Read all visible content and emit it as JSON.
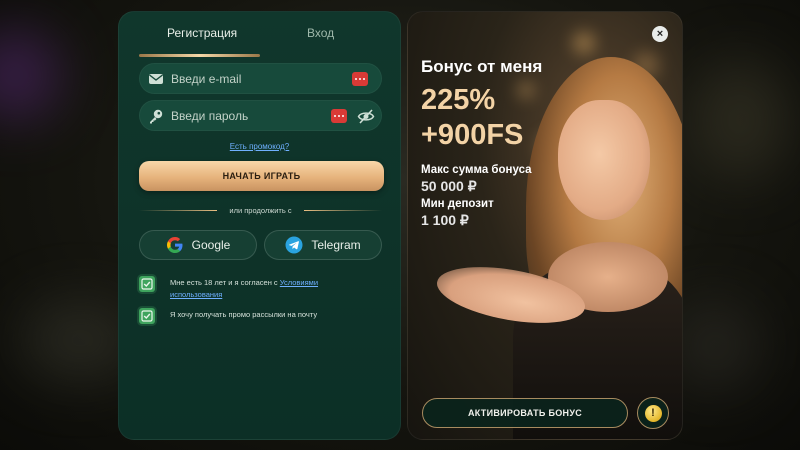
{
  "registration": {
    "tabs": [
      {
        "label": "Регистрация",
        "active": true
      },
      {
        "label": "Вход",
        "active": false
      }
    ],
    "email": {
      "placeholder": "Введи e-mail",
      "icon": "envelope-icon",
      "value": ""
    },
    "password": {
      "placeholder": "Введи пароль",
      "icon": "key-icon",
      "value": ""
    },
    "promo_link": "Есть промокод?",
    "submit_label": "НАЧАТЬ ИГРАТЬ",
    "divider_text": "или продолжить с",
    "social": [
      {
        "label": "Google",
        "icon": "google-icon"
      },
      {
        "label": "Telegram",
        "icon": "telegram-icon"
      }
    ],
    "consents": [
      {
        "text": "Мне есть 18 лет и я согласен с",
        "link": "Условиями использования",
        "checked": true
      },
      {
        "text": "Я хочу получать промо рассылки на почту",
        "checked": true
      }
    ]
  },
  "bonus": {
    "title": "Бонус от меня",
    "percent": "225%",
    "freespins": "+900FS",
    "max_label": "Макс сумма бонуса",
    "max_value": "50 000 ₽",
    "min_label": "Мин депозит",
    "min_value": "1 100 ₽",
    "activate_label": "АКТИВИРОВАТЬ БОНУС",
    "close_glyph": "×",
    "alert_glyph": "!"
  },
  "colors": {
    "panel_green": "#0f3a2e",
    "gold": "#f3d3a6",
    "checkbox_green": "#3fa45e",
    "link_blue": "#6fb0ff",
    "red_action": "#d93a36"
  }
}
